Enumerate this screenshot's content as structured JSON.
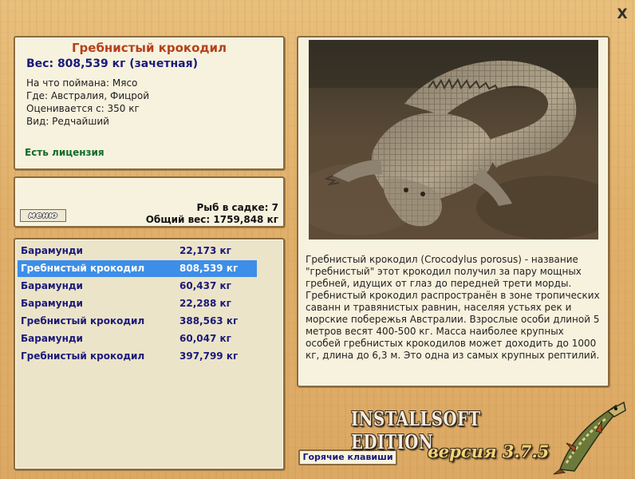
{
  "window": {
    "close_label": "X"
  },
  "info": {
    "title": "Гребнистый крокодил",
    "weight": "Вес: 808,539 кг (зачетная)",
    "bait": "На что поймана: Мясо",
    "location": "Где: Австралия, Фицрой",
    "valued_from": "Оценивается с: 350 кг",
    "rarity": "Вид: Редчайший",
    "license": "Есть лицензия"
  },
  "menu": {
    "button_label": "меню",
    "fish_in_net": "Рыб в садке: 7",
    "total_weight": "Общий вес: 1759,848 кг"
  },
  "catch_list": [
    {
      "name": "Барамунди",
      "weight": "22,173 кг",
      "selected": false
    },
    {
      "name": "Гребнистый крокодил",
      "weight": "808,539 кг",
      "selected": true
    },
    {
      "name": "Барамунди",
      "weight": "60,437 кг",
      "selected": false
    },
    {
      "name": "Барамунди",
      "weight": "22,288 кг",
      "selected": false
    },
    {
      "name": "Гребнистый крокодил",
      "weight": "388,563 кг",
      "selected": false
    },
    {
      "name": "Барамунди",
      "weight": "60,047 кг",
      "selected": false
    },
    {
      "name": "Гребнистый крокодил",
      "weight": "397,799 кг",
      "selected": false
    }
  ],
  "description": "Гребнистый крокодил (Crocodylus porosus) - название \"гребнистый\" этот крокодил получил за пару мощных гребней, идущих от глаз до передней трети морды. Гребнистый крокодил распространён в зоне тропических саванн и травянистых равнин, населяя устьях рек и морские побережья Австралии. Взрослые особи длиной 5 метров весят 400-500 кг. Масса наиболее крупных особей гребнистых крокодилов может доходить до 1000 кг, длина до 6,3 м. Это одна из самых крупных рептилий.",
  "footer": {
    "hotkeys_label": "Горячие клавиши",
    "brand": "INSTALLSOFT EDITION",
    "version": "версия 3.7.5"
  },
  "colors": {
    "selection": "#3d8ee8",
    "title": "#b5401a",
    "list_text": "#1a1a7a",
    "license": "#0f6b2a"
  },
  "icons": {
    "close": "close-icon",
    "logo": "pike-fish-logo"
  }
}
